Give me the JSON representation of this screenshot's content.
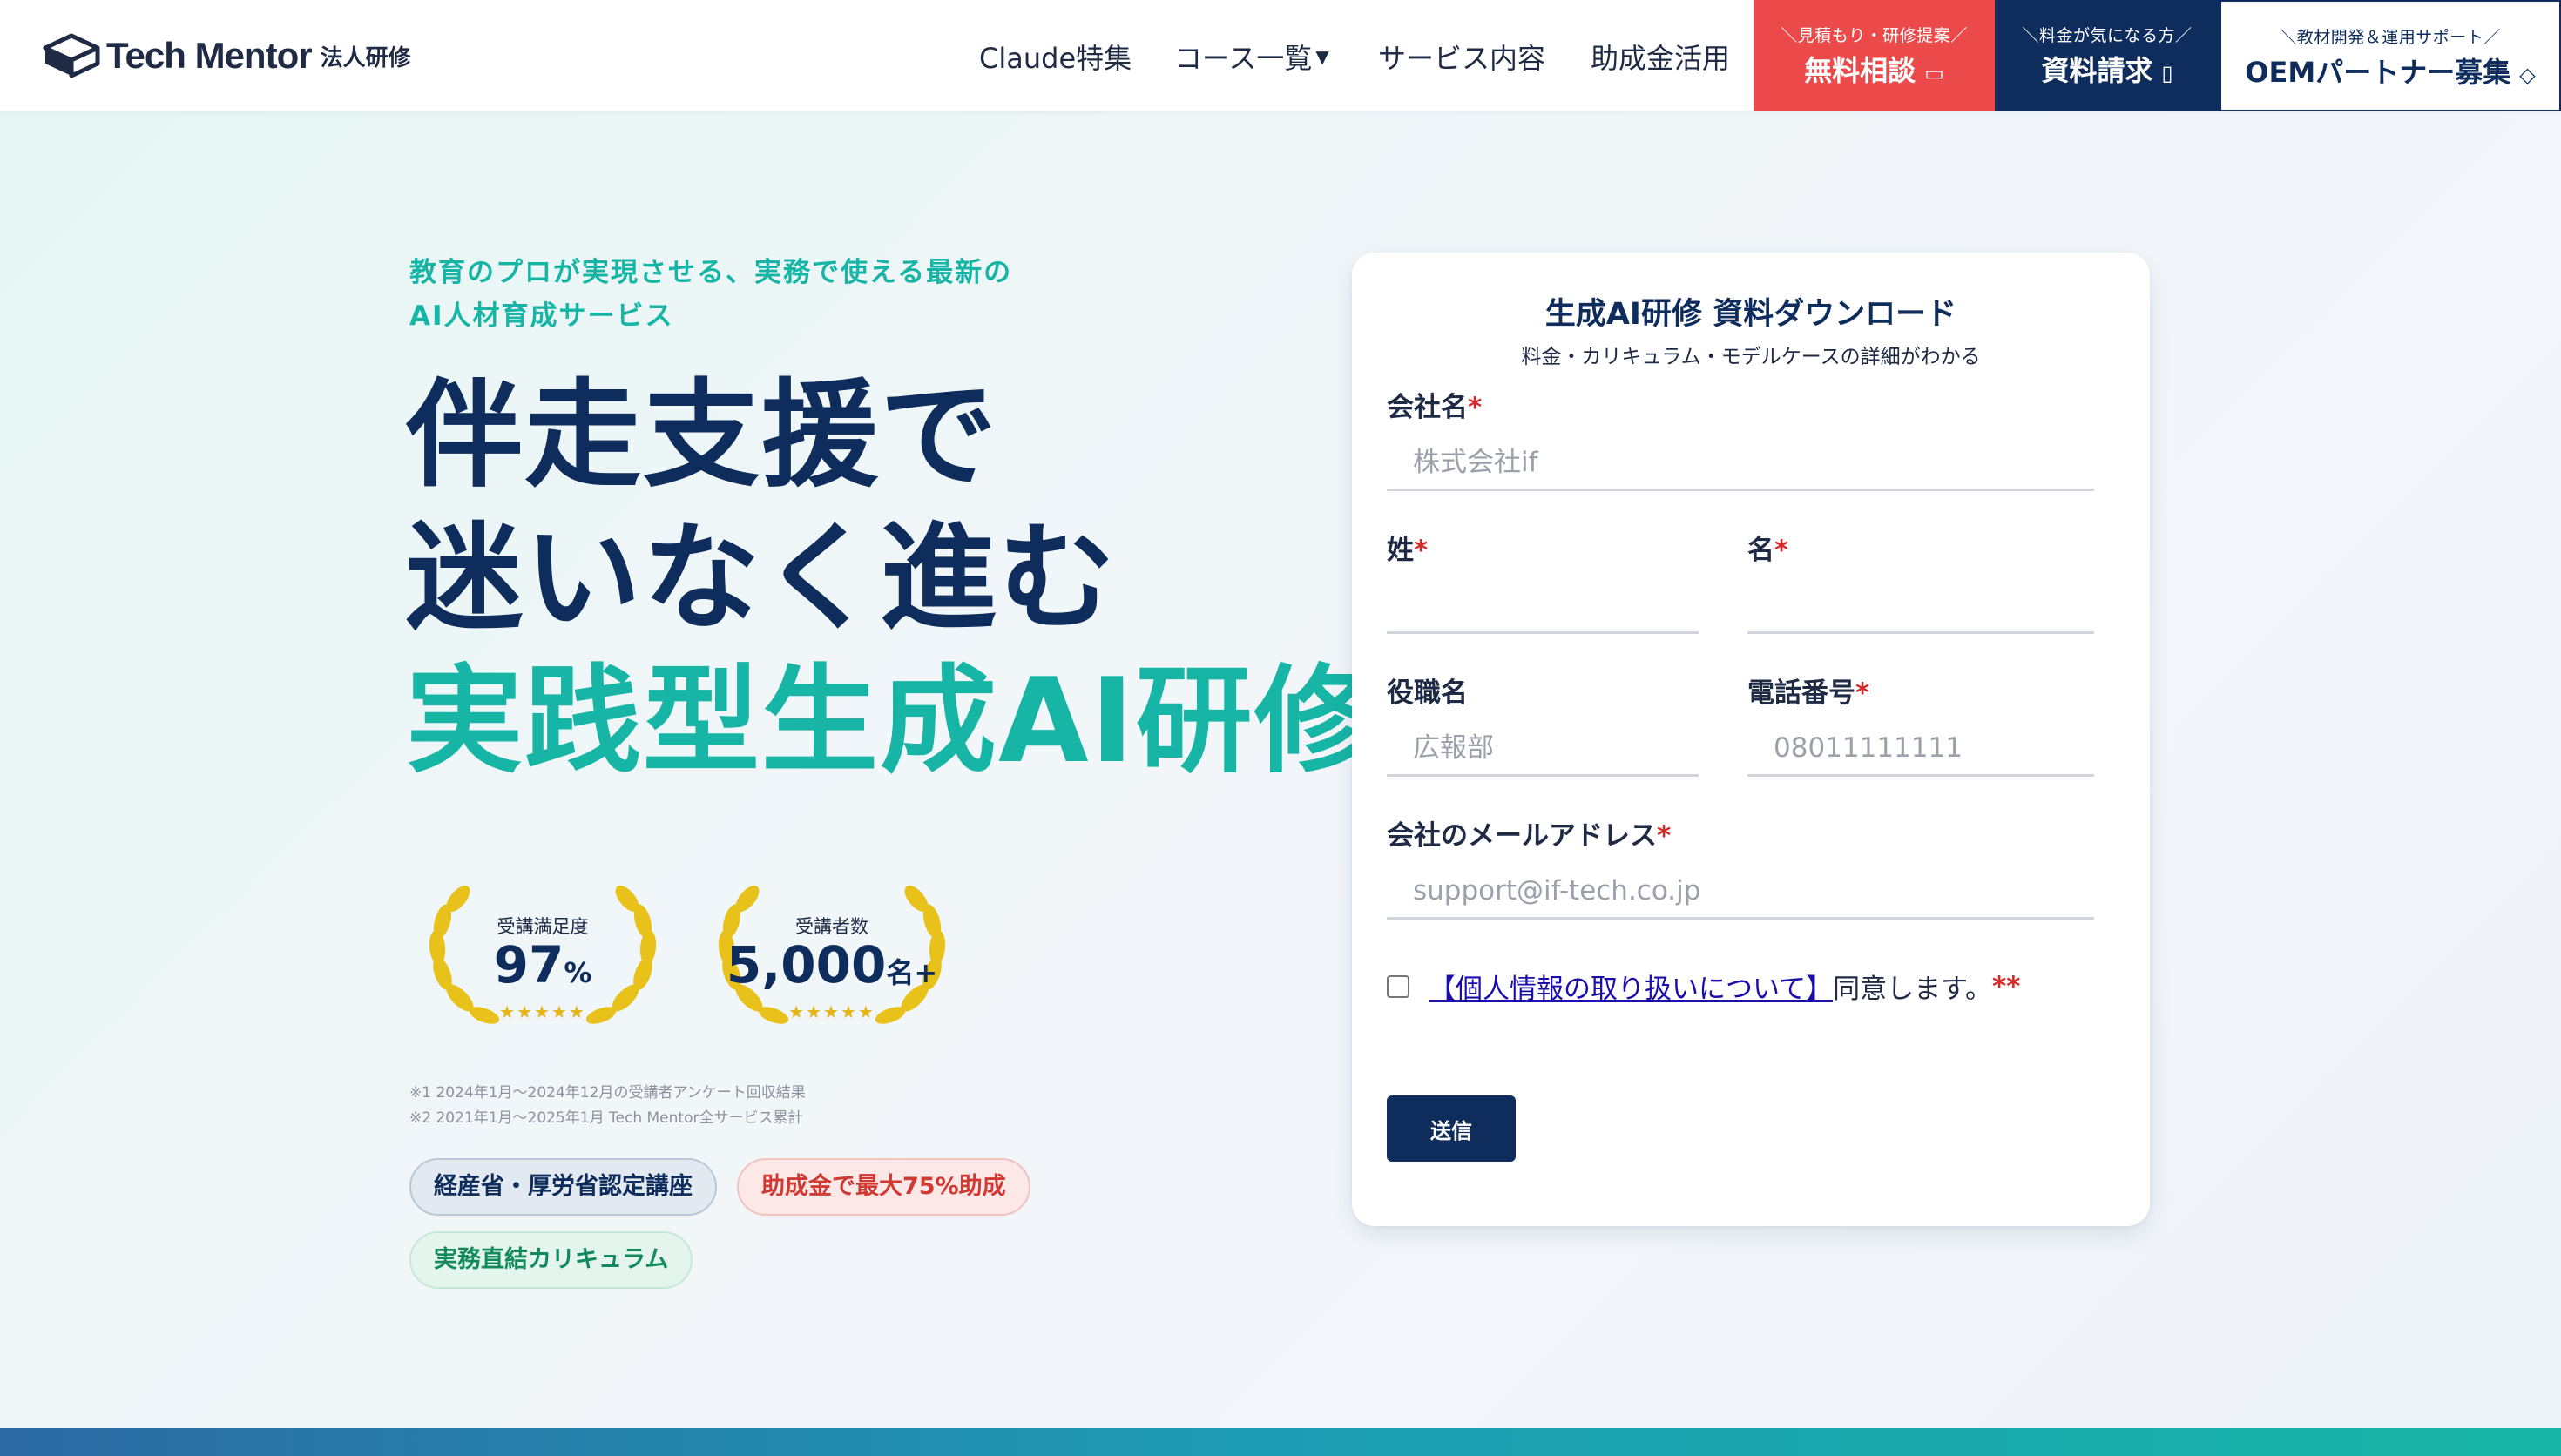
{
  "header": {
    "logo_text": "Tech Mentor",
    "logo_sub": "法人研修",
    "nav": [
      {
        "label": "Claude特集"
      },
      {
        "label": "コース一覧"
      },
      {
        "label": "サービス内容"
      },
      {
        "label": "助成金活用"
      }
    ],
    "cta": {
      "consult_pre": "＼見積もり・研修提案／",
      "consult_label": "無料相談",
      "docs_pre": "＼料金が気になる方／",
      "docs_label": "資料請求",
      "oem_pre": "＼教材開発＆運用サポート／",
      "oem_label": "OEMパートナー募集"
    }
  },
  "hero": {
    "tagline_1": "教育のプロが実現させる、実務で使える最新の",
    "tagline_2": "AI人材育成サービス",
    "headline_1": "伴走支援で",
    "headline_2": "迷いなく進む",
    "headline_3": "実践型生成AI研修",
    "awards": [
      {
        "label": "受講満足度",
        "value": "97",
        "unit": "%",
        "stars": "★★★★★"
      },
      {
        "label": "受講者数",
        "value": "5,000",
        "unit": "名+",
        "stars": "★★★★★"
      }
    ],
    "notes": [
      "※1 2024年1月〜2024年12月の受講者アンケート回収結果",
      "※2 2021年1月〜2025年1月 Tech Mentor全サービス累計"
    ],
    "badges": {
      "certified": "経産省・厚労省認定講座",
      "subsidy": "助成金で最大75%助成",
      "curriculum": "実務直結カリキュラム"
    }
  },
  "form": {
    "title": "生成AI研修 資料ダウンロード",
    "subtitle": "料金・カリキュラム・モデルケースの詳細がわかる",
    "required_mark": "*",
    "company_label": "会社名",
    "company_placeholder": "株式会社if",
    "last_name_label": "姓",
    "first_name_label": "名",
    "title_label": "役職名",
    "title_placeholder": "広報部",
    "phone_label": "電話番号",
    "phone_placeholder": "08011111111",
    "email_label": "会社のメールアドレス",
    "email_placeholder": "support@if-tech.co.jp",
    "consent_link": "【個人情報の取り扱いについて】",
    "consent_text": "同意します。",
    "consent_req": "**",
    "submit_label": "送信"
  },
  "colors": {
    "navy": "#0f2d5c",
    "teal": "#17b5a5",
    "red": "#ec4a4a"
  }
}
